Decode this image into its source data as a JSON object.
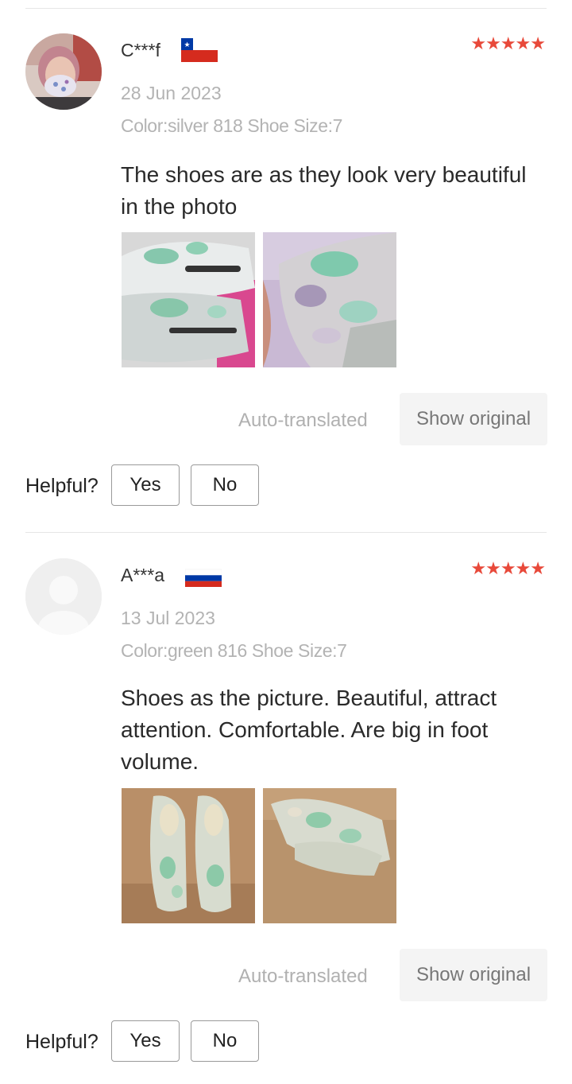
{
  "reviews": [
    {
      "name": "C***f",
      "country_flag": "chile-flag",
      "stars": "★★★★★",
      "date": "28 Jun 2023",
      "sku": "Color:silver 818 Shoe Size:7",
      "text": "The shoes are as they look very beautiful in the photo",
      "auto_translated": "Auto-translated",
      "show_original": "Show original",
      "helpful_label": "Helpful?",
      "yes": "Yes",
      "no": "No"
    },
    {
      "name": "A***a",
      "country_flag": "russia-flag",
      "stars": "★★★★★",
      "date": "13 Jul 2023",
      "sku": "Color:green 816 Shoe Size:7",
      "text": "Shoes as the picture. Beautiful, attract attention. Comfortable. Are big in foot volume.",
      "auto_translated": "Auto-translated",
      "show_original": "Show original",
      "helpful_label": "Helpful?",
      "yes": "Yes",
      "no": "No"
    }
  ],
  "colors": {
    "star": "#e8493a",
    "muted_text": "#b3b3b3",
    "divider": "#e6e6e6"
  }
}
